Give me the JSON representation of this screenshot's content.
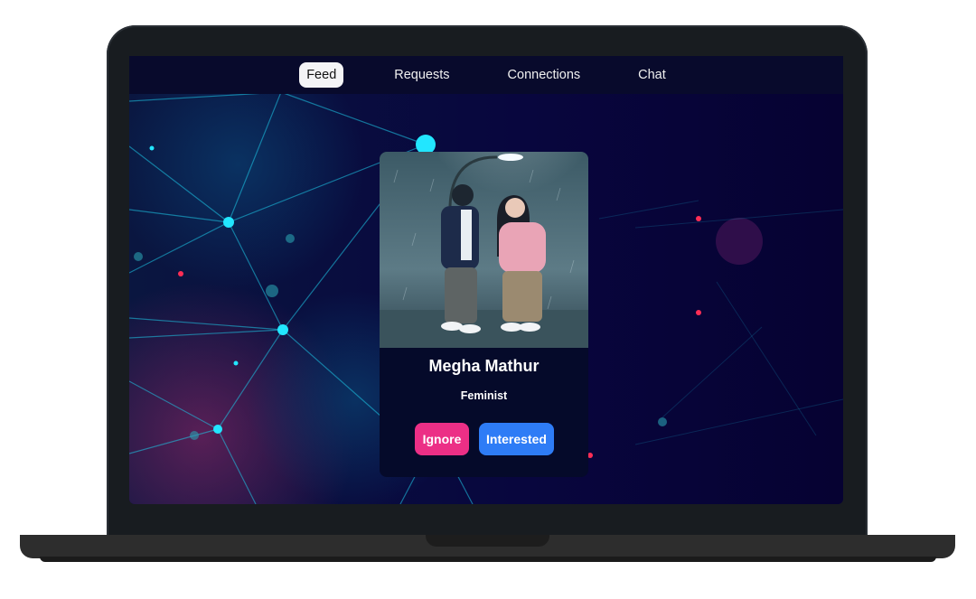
{
  "nav": {
    "items": [
      {
        "label": "Feed",
        "active": true
      },
      {
        "label": "Requests",
        "active": false
      },
      {
        "label": "Connections",
        "active": false
      },
      {
        "label": "Chat",
        "active": false
      }
    ]
  },
  "card": {
    "name": "Megha Mathur",
    "about": "Feminist",
    "ignore_label": "Ignore",
    "interested_label": "Interested",
    "photo_icon": "couple-in-rain-illustration"
  },
  "colors": {
    "screen_bg": "#07053a",
    "nav_bg": "#080a2c",
    "card_bg": "#050a2a",
    "ignore": "#ec2f86",
    "interested": "#2e7cf6",
    "network_line": "#1ec8e8"
  }
}
